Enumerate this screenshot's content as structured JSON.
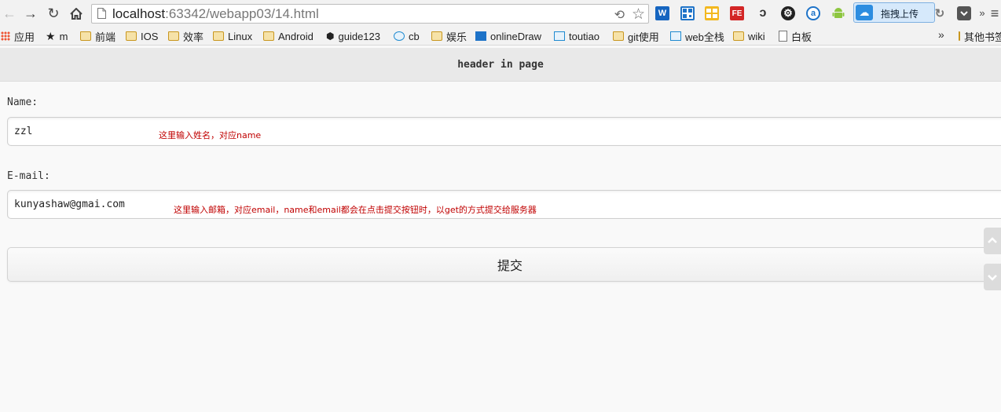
{
  "browser": {
    "url_host": "localhost",
    "url_rest": ":63342/webapp03/14.html",
    "upload_label": "拖拽上传",
    "bookmarks": [
      {
        "label": "应用"
      },
      {
        "label": "m"
      },
      {
        "label": "前端"
      },
      {
        "label": "IOS"
      },
      {
        "label": "效率"
      },
      {
        "label": "Linux"
      },
      {
        "label": "Android"
      },
      {
        "label": "guide123"
      },
      {
        "label": "cb"
      },
      {
        "label": "娱乐"
      },
      {
        "label": "onlineDraw"
      },
      {
        "label": "toutiao"
      },
      {
        "label": "git使用"
      },
      {
        "label": "web全栈"
      },
      {
        "label": "wiki"
      },
      {
        "label": "白板"
      },
      {
        "label": "其他书签"
      }
    ],
    "colors": {
      "accent": "#2d8de0",
      "annotation": "#c00000"
    }
  },
  "page": {
    "header": "header in page",
    "name_label": "Name:",
    "name_value": "zzl",
    "name_annotation": "这里输入姓名，对应name",
    "email_label": "E-mail:",
    "email_value": "kunyashaw@gmai.com",
    "email_annotation": "这里输入邮箱，对应email，name和email都会在点击提交按钮时，以get的方式提交给服务器",
    "submit_label": "提交"
  }
}
